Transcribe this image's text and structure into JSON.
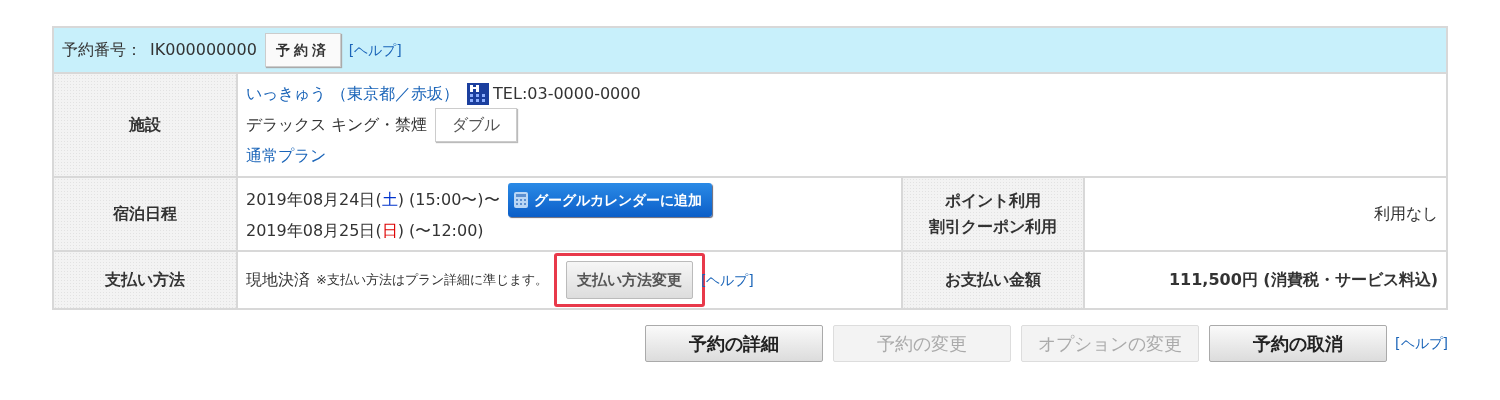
{
  "header": {
    "label": "予約番号：",
    "number": "IK000000000",
    "status": "予約済",
    "help": "[ヘルプ]"
  },
  "facility": {
    "label": "施設",
    "name": "いっきゅう （東京都／赤坂）",
    "tel": "TEL:03-0000-0000",
    "room": "デラックス キング・禁煙",
    "bed": "ダブル",
    "plan": "通常プラン"
  },
  "stay": {
    "label": "宿泊日程",
    "dates": [
      {
        "prefix": "2019年08月24日(",
        "weekday": "土",
        "color": "#0033cc",
        "suffix": ") (15:00〜)〜"
      },
      {
        "prefix": "2019年08月25日(",
        "weekday": "日",
        "color": "#dd0000",
        "suffix": ") (〜12:00)"
      }
    ],
    "calendar_button": "グーグルカレンダーに追加"
  },
  "points": {
    "label_lines": [
      "ポイント利用",
      "割引クーポン利用"
    ],
    "value": "利用なし"
  },
  "payment": {
    "label": "支払い方法",
    "method": "現地決済",
    "note": "※支払い方法はプラン詳細に準じます。",
    "change_button": {
      "label": "支払い方法変更",
      "highlighted": true
    },
    "help": "[ヘルプ]"
  },
  "amount": {
    "label": "お支払い金額",
    "value": "111,500円 (消費税・サービス料込)"
  },
  "actions": [
    {
      "label": "予約の詳細",
      "disabled": false
    },
    {
      "label": "予約の変更",
      "disabled": true
    },
    {
      "label": "オプションの変更",
      "disabled": true
    },
    {
      "label": "予約の取消",
      "disabled": false
    }
  ],
  "actions_help": "[ヘルプ]"
}
